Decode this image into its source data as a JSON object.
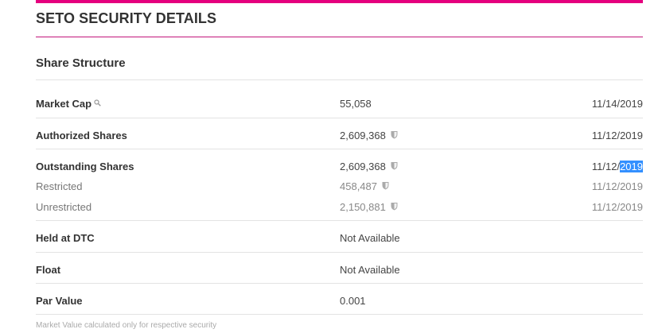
{
  "header": {
    "title": "SETO SECURITY DETAILS",
    "accent_color": "#e5007e"
  },
  "section": {
    "title": "Share Structure"
  },
  "rows": {
    "market_cap": {
      "label": "Market Cap",
      "value": "55,058",
      "date": "11/14/2019",
      "icon": "magnifier-icon"
    },
    "authorized_shares": {
      "label": "Authorized Shares",
      "value": "2,609,368",
      "date": "11/12/2019",
      "icon": "shield-icon"
    },
    "outstanding_shares": {
      "label": "Outstanding Shares",
      "value": "2,609,368",
      "date_prefix": "11/12/",
      "date_selected": "2019",
      "icon": "shield-icon"
    },
    "restricted": {
      "label": "Restricted",
      "value": "458,487",
      "date": "11/12/2019",
      "icon": "shield-icon"
    },
    "unrestricted": {
      "label": "Unrestricted",
      "value": "2,150,881",
      "date": "11/12/2019",
      "icon": "shield-icon"
    },
    "held_at_dtc": {
      "label": "Held at DTC",
      "value": "Not Available"
    },
    "float": {
      "label": "Float",
      "value": "Not Available"
    },
    "par_value": {
      "label": "Par Value",
      "value": "0.001"
    }
  },
  "footnote": "Market Value calculated only for respective security"
}
